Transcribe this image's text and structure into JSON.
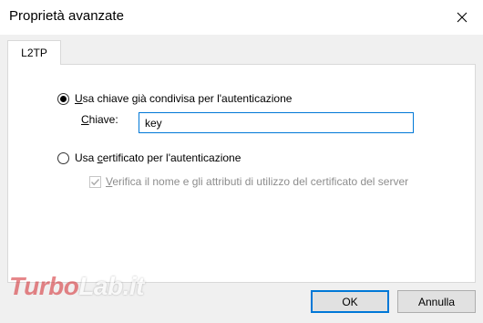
{
  "window": {
    "title": "Proprietà avanzate"
  },
  "tabs": [
    {
      "label": "L2TP",
      "selected": true
    }
  ],
  "options": {
    "preshared_key": {
      "label_underlined": "U",
      "label_rest": "sa chiave già condivisa per l'autenticazione",
      "selected": true
    },
    "key_field": {
      "label_underlined": "C",
      "label_rest": "hiave:",
      "value": "key"
    },
    "certificate": {
      "label_pre": "Usa ",
      "label_underlined": "c",
      "label_rest": "ertificato per l'autenticazione",
      "selected": false
    },
    "verify_cert": {
      "label_underlined": "V",
      "label_rest": "erifica il nome e gli attributi di utilizzo del certificato del server",
      "checked": true,
      "disabled": true
    }
  },
  "buttons": {
    "ok": "OK",
    "cancel": "Annulla"
  },
  "watermark": {
    "part1": "Turbo",
    "part2": "Lab.it"
  },
  "colors": {
    "accent": "#0078d7",
    "disabled_text": "#8d8d8d",
    "watermark_red": "#d3262b"
  }
}
